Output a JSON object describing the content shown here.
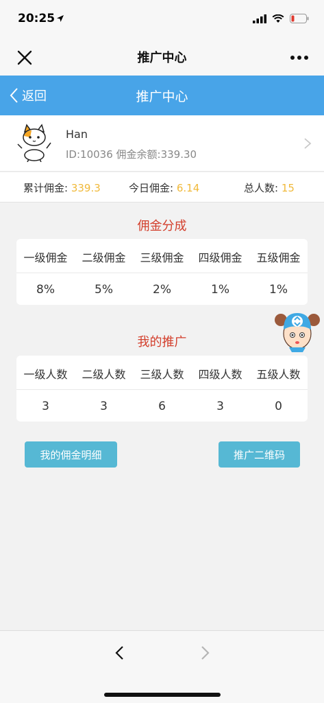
{
  "status_bar": {
    "time": "20:25"
  },
  "wechat_bar": {
    "title": "推广中心"
  },
  "header": {
    "back_label": "返回",
    "title": "推广中心",
    "color": "#48a4e8"
  },
  "profile": {
    "name": "Han",
    "info": "ID:10036 佣金余额:339.30"
  },
  "stats": {
    "total_label": "累计佣金:",
    "total_value": "339.3",
    "today_label": "今日佣金:",
    "today_value": "6.14",
    "people_label": "总人数:",
    "people_value": "15",
    "value_color": "#f0b93a"
  },
  "commission": {
    "title": "佣金分成",
    "headers": [
      "一级佣金",
      "二级佣金",
      "三级佣金",
      "四级佣金",
      "五级佣金"
    ],
    "values": [
      "8%",
      "5%",
      "2%",
      "1%",
      "1%"
    ]
  },
  "promotion": {
    "title": "我的推广",
    "headers": [
      "一级人数",
      "二级人数",
      "三级人数",
      "四级人数",
      "五级人数"
    ],
    "values": [
      "3",
      "3",
      "6",
      "3",
      "0"
    ]
  },
  "buttons": {
    "details": "我的佣金明细",
    "qrcode": "推广二维码",
    "color": "#56b8d4"
  },
  "icons": [
    "location-arrow-icon",
    "signal-icon",
    "wifi-icon",
    "battery-icon",
    "close-icon",
    "more-icon",
    "chevron-left-icon",
    "chevron-right-icon",
    "cat-avatar",
    "mascot-icon"
  ]
}
